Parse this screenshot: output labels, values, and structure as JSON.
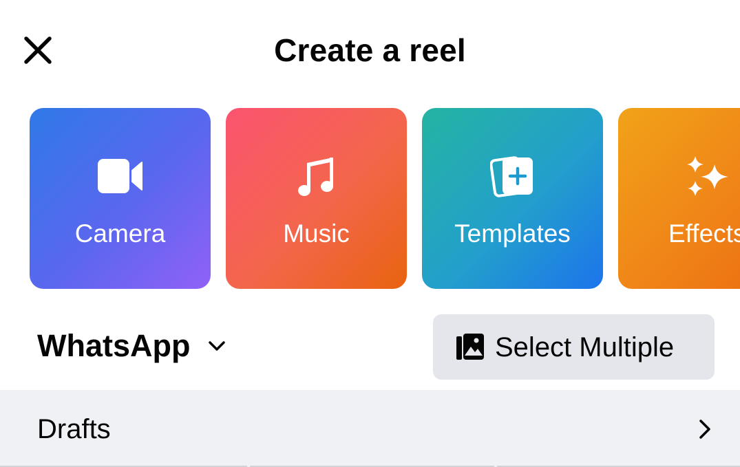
{
  "header": {
    "title": "Create a reel",
    "close_icon": "close-icon"
  },
  "tiles": [
    {
      "label": "Camera",
      "icon": "video-camera-icon",
      "colors": [
        "#2f79e8",
        "#9161f7"
      ]
    },
    {
      "label": "Music",
      "icon": "music-note-icon",
      "colors": [
        "#fb5470",
        "#e9630f"
      ]
    },
    {
      "label": "Templates",
      "icon": "templates-add-icon",
      "colors": [
        "#24b4a2",
        "#1c74ec"
      ]
    },
    {
      "label": "Effects",
      "icon": "sparkles-icon",
      "colors": [
        "#f1a219",
        "#eb6a10"
      ]
    }
  ],
  "album": {
    "name": "WhatsApp",
    "chevron_icon": "chevron-down-icon"
  },
  "select_multiple": {
    "label": "Select Multiple",
    "icon": "photo-stack-icon",
    "background": "#e4e6eb"
  },
  "drafts": {
    "label": "Drafts",
    "chevron_icon": "chevron-right-icon",
    "background": "#f0f1f5"
  }
}
